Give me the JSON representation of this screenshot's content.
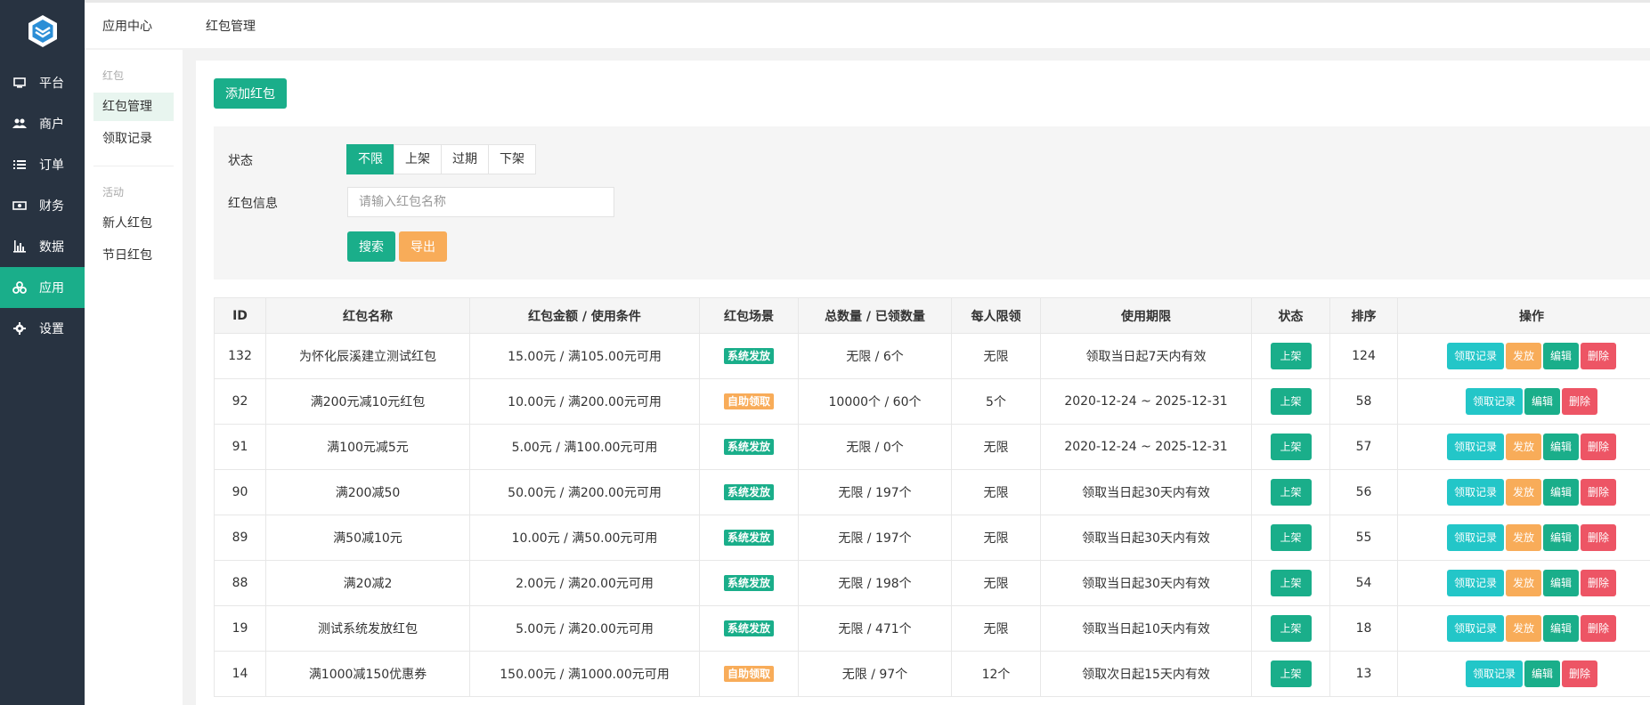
{
  "sidebar": {
    "items": [
      {
        "label": "平台",
        "icon": "monitor-icon"
      },
      {
        "label": "商户",
        "icon": "users-icon"
      },
      {
        "label": "订单",
        "icon": "list-icon"
      },
      {
        "label": "财务",
        "icon": "money-icon"
      },
      {
        "label": "数据",
        "icon": "bar-chart-icon"
      },
      {
        "label": "应用",
        "icon": "apps-icon",
        "active": true
      },
      {
        "label": "设置",
        "icon": "gear-icon"
      }
    ]
  },
  "topbar": {
    "section": "应用中心",
    "page": "红包管理"
  },
  "subnav": {
    "group1": "红包",
    "group1_items": [
      "红包管理",
      "领取记录"
    ],
    "group2": "活动",
    "group2_items": [
      "新人红包",
      "节日红包"
    ]
  },
  "actions": {
    "add_label": "添加红包"
  },
  "filter": {
    "status_label": "状态",
    "status_options": [
      "不限",
      "上架",
      "过期",
      "下架"
    ],
    "info_label": "红包信息",
    "info_placeholder": "请输入红包名称",
    "search_label": "搜索",
    "export_label": "导出"
  },
  "table": {
    "headers": [
      "ID",
      "红包名称",
      "红包金额 / 使用条件",
      "红包场景",
      "总数量 / 已领数量",
      "每人限领",
      "使用期限",
      "状态",
      "排序",
      "操作"
    ],
    "rows": [
      {
        "id": "132",
        "name": "为怀化辰溪建立测试红包",
        "amount": "15.00元 / 满105.00元可用",
        "scene": "系统发放",
        "qty": "无限 / 6个",
        "limit": "无限",
        "period": "领取当日起7天内有效",
        "status": "上架",
        "sort": "124",
        "ops": [
          "领取记录",
          "发放",
          "编辑",
          "删除"
        ]
      },
      {
        "id": "92",
        "name": "满200元减10元红包",
        "amount": "10.00元 / 满200.00元可用",
        "scene": "自助领取",
        "qty": "10000个 / 60个",
        "limit": "5个",
        "period": "2020-12-24 ~ 2025-12-31",
        "status": "上架",
        "sort": "58",
        "ops": [
          "领取记录",
          "编辑",
          "删除"
        ]
      },
      {
        "id": "91",
        "name": "满100元减5元",
        "amount": "5.00元 / 满100.00元可用",
        "scene": "系统发放",
        "qty": "无限 / 0个",
        "limit": "无限",
        "period": "2020-12-24 ~ 2025-12-31",
        "status": "上架",
        "sort": "57",
        "ops": [
          "领取记录",
          "发放",
          "编辑",
          "删除"
        ]
      },
      {
        "id": "90",
        "name": "满200减50",
        "amount": "50.00元 / 满200.00元可用",
        "scene": "系统发放",
        "qty": "无限 / 197个",
        "limit": "无限",
        "period": "领取当日起30天内有效",
        "status": "上架",
        "sort": "56",
        "ops": [
          "领取记录",
          "发放",
          "编辑",
          "删除"
        ]
      },
      {
        "id": "89",
        "name": "满50减10元",
        "amount": "10.00元 / 满50.00元可用",
        "scene": "系统发放",
        "qty": "无限 / 197个",
        "limit": "无限",
        "period": "领取当日起30天内有效",
        "status": "上架",
        "sort": "55",
        "ops": [
          "领取记录",
          "发放",
          "编辑",
          "删除"
        ]
      },
      {
        "id": "88",
        "name": "满20减2",
        "amount": "2.00元 / 满20.00元可用",
        "scene": "系统发放",
        "qty": "无限 / 198个",
        "limit": "无限",
        "period": "领取当日起30天内有效",
        "status": "上架",
        "sort": "54",
        "ops": [
          "领取记录",
          "发放",
          "编辑",
          "删除"
        ]
      },
      {
        "id": "19",
        "name": "测试系统发放红包",
        "amount": "5.00元 / 满20.00元可用",
        "scene": "系统发放",
        "qty": "无限 / 471个",
        "limit": "无限",
        "period": "领取当日起10天内有效",
        "status": "上架",
        "sort": "18",
        "ops": [
          "领取记录",
          "发放",
          "编辑",
          "删除"
        ]
      },
      {
        "id": "14",
        "name": "满1000减150优惠券",
        "amount": "150.00元 / 满1000.00元可用",
        "scene": "自助领取",
        "qty": "无限 / 97个",
        "limit": "12个",
        "period": "领取次日起15天内有效",
        "status": "上架",
        "sort": "13",
        "ops": [
          "领取记录",
          "编辑",
          "删除"
        ]
      }
    ]
  },
  "colors": {
    "sidebar_bg": "#283341",
    "primary": "#1aae8a",
    "orange": "#f8ac59",
    "cyan": "#23c6c8",
    "red": "#ed5565"
  }
}
